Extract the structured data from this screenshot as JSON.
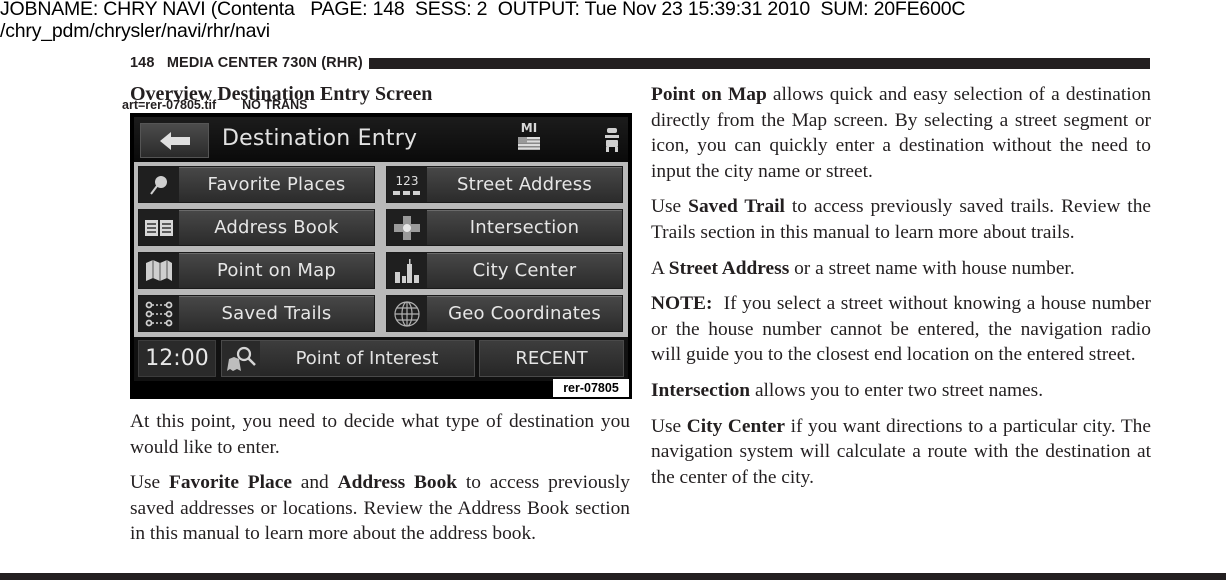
{
  "print_header": {
    "line1": "JOBNAME: CHRY NAVI (Contenta   PAGE: 148  SESS: 2  OUTPUT: Tue Nov 23 15:39:31 2010  SUM: 20FE600C",
    "line2": "/chry_pdm/chrysler/navi/rhr/navi"
  },
  "running_head": "148   MEDIA CENTER 730N (RHR)",
  "section": {
    "title": "Overview Destination Entry Screen",
    "art_file": "art=rer-07805.tif",
    "art_note": "NO TRANS"
  },
  "nav_screen": {
    "title": "Destination Entry",
    "back_icon": "arrow-left-icon",
    "region": "MI",
    "region_icon": "us-flag-icon",
    "vehicle_icon": "car-icon",
    "buttons_left": [
      {
        "label": "Favorite Places",
        "icon": "pushpin-icon"
      },
      {
        "label": "Address Book",
        "icon": "book-icon"
      },
      {
        "label": "Point on Map",
        "icon": "map-icon"
      },
      {
        "label": "Saved Trails",
        "icon": "trail-icon"
      }
    ],
    "buttons_right": [
      {
        "label": "Street Address",
        "icon": "house-number-icon",
        "icon_text": "123"
      },
      {
        "label": "Intersection",
        "icon": "intersection-icon"
      },
      {
        "label": "City Center",
        "icon": "city-icon"
      },
      {
        "label": "Geo Coordinates",
        "icon": "globe-icon"
      }
    ],
    "clock": "12:00",
    "poi_label": "Point of Interest",
    "poi_icon": "poi-search-icon",
    "recent_label": "RECENT",
    "figure_code": "rer-07805"
  },
  "left_column": {
    "p1": "At this point, you need to decide what type of destination you would like to enter.",
    "p2": {
      "pre": "Use ",
      "b1": "Favorite Place",
      "mid": " and ",
      "b2": "Address Book",
      "post": " to access previously saved addresses or locations. Review the Address Book section in this manual to learn more about the address book."
    }
  },
  "right_column": {
    "p1": {
      "b": "Point on Map",
      "post": " allows quick and easy selection of a destination directly from the Map screen. By selecting a street segment or icon, you can quickly enter a destination without the need to input the city name or street."
    },
    "p2": {
      "pre": "Use ",
      "b": "Saved Trail",
      "post": " to access previously saved trails. Review the Trails section in this manual to learn more about trails."
    },
    "p3": {
      "pre": "A ",
      "b": "Street Address",
      "post": " or a street name with house number."
    },
    "p4": {
      "b": "NOTE:",
      "post": "  If you select a street without knowing a house number or the house number cannot be entered, the navigation radio will guide you to the closest end location on the entered street."
    },
    "p5": {
      "b": "Intersection",
      "post": " allows you to enter two street names."
    },
    "p6": {
      "pre": "Use ",
      "b": "City Center",
      "post": " if you want directions to a particular city. The navigation system will calculate a route with the destination at the center of the city."
    }
  }
}
